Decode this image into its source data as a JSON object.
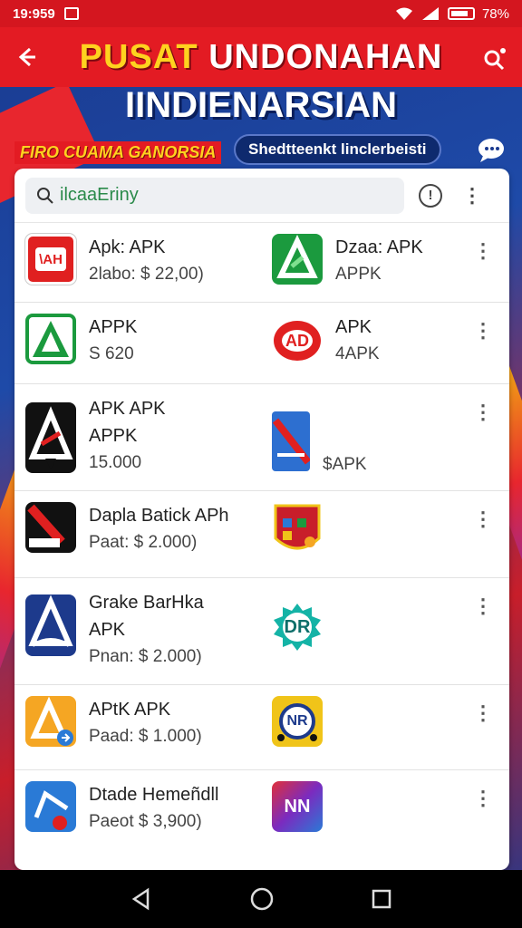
{
  "status": {
    "time": "19:959",
    "battery": "78%"
  },
  "header": {
    "title_part1": "PUSAT",
    "title_part2": "UNDONAHAN",
    "title_line2": "IINDIENARSIAN",
    "promo": "FIRO CUAMA GANORSIA",
    "pill": "Shedtteenkt linclerbeisti"
  },
  "search": {
    "value": "ilcaaEriny"
  },
  "apps": [
    {
      "left": {
        "name": "Apk: APK",
        "sub": "2labo: $ 22,00)",
        "icon": "red-ah-icon"
      },
      "right": {
        "name": "Dzaa: APK",
        "sub": "APPK",
        "icon": "green-triangle-icon"
      }
    },
    {
      "left": {
        "name": "APPK",
        "sub": "S 620",
        "icon": "green-outline-triangle-icon"
      },
      "right": {
        "name": "APK",
        "sub": "4APK",
        "icon": "red-ad-icon"
      }
    },
    {
      "left": {
        "name": "APK APK",
        "name2": "APPK",
        "sub": "15.000",
        "icon": "black-a-icon"
      },
      "right": {
        "name": "",
        "sub": "$APK",
        "icon": "blue-card-icon"
      }
    },
    {
      "left": {
        "name": "Dapla Batick APh",
        "sub": "Paat: $ 2.000)",
        "icon": "black-red-stripe-icon"
      },
      "right": {
        "name": "",
        "sub": "",
        "icon": "shield-apps-icon"
      }
    },
    {
      "left": {
        "name": "Grake BarHka",
        "name2": "APK",
        "sub": "Pnan: $ 2.000)",
        "icon": "navy-a-icon"
      },
      "right": {
        "name": "",
        "sub": "",
        "icon": "dr-flower-icon"
      }
    },
    {
      "left": {
        "name": "APtK APK",
        "sub": "Paad: $ 1.000)",
        "icon": "orange-a-icon"
      },
      "right": {
        "name": "",
        "sub": "",
        "icon": "nr-badge-icon"
      }
    },
    {
      "left": {
        "name": "Dtade Hemeñdll",
        "sub": "Paeot $ 3,900)",
        "icon": "blue-square-icon"
      },
      "right": {
        "name": "",
        "sub": "",
        "icon": "gradient-nn-icon"
      }
    }
  ],
  "icon_glyphs": {
    "red_ah": "\\AH",
    "red_ad": "AD",
    "dr": "DR",
    "nr": "NR",
    "nn": "NN"
  },
  "colors": {
    "header_red": "#e31b23",
    "accent_yellow": "#ffd21f",
    "navy": "#0e2a6e"
  }
}
